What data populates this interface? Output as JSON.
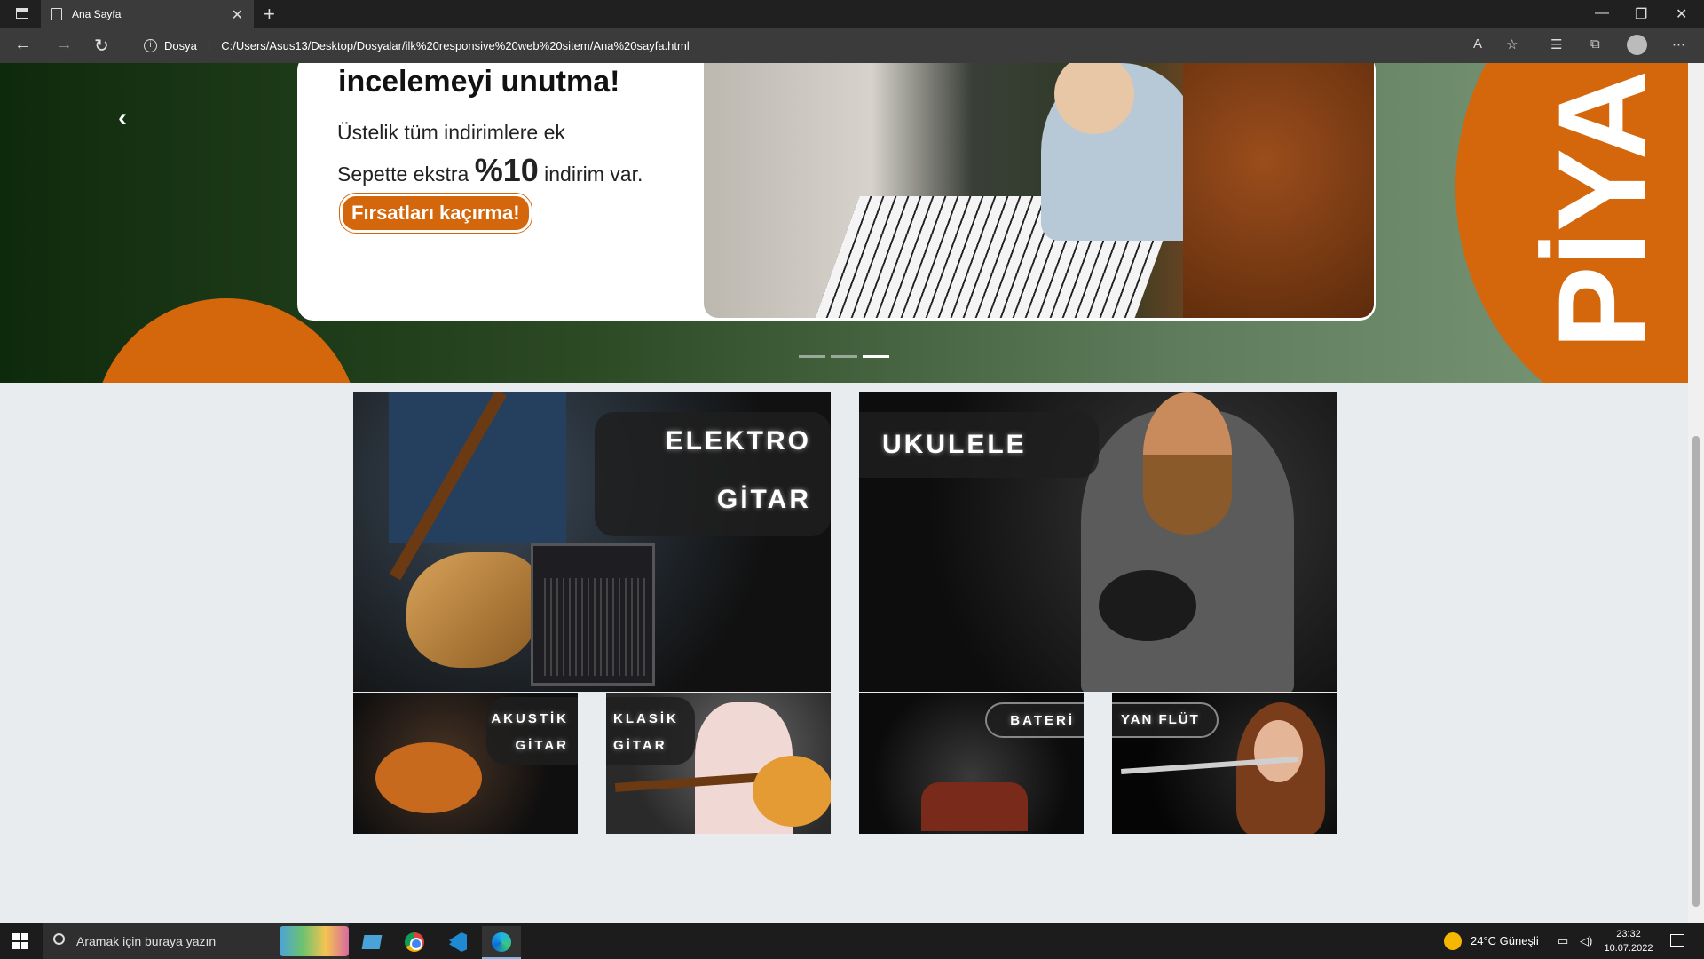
{
  "browser": {
    "tab_title": "Ana Sayfa",
    "new_tab": "+",
    "close_tab": "✕",
    "security_label": "Dosya",
    "url": "C:/Users/Asus13/Desktop/Dosyalar/ilk%20responsive%20web%20sitem/Ana%20sayfa.html",
    "window_minimize": "—",
    "window_restore": "❐",
    "window_close": "✕"
  },
  "hero": {
    "heading": "incelemeyi unutma!",
    "line1": "Üstelik tüm indirimlere ek",
    "line2_pre": "Sepette ekstra ",
    "line2_bold": "%10",
    "line2_post": " indirim var.",
    "cta": "Fırsatları kaçırma!",
    "side_text": "PİYA",
    "prev_arrow": "‹",
    "slides": 3,
    "active_slide": 3
  },
  "categories": {
    "elektro_line1": "ELEKTRO",
    "elektro_line2": "GİTAR",
    "ukulele": "UKULELE",
    "akustik_line1": "AKUSTİK",
    "akustik_line2": "GİTAR",
    "klasik_line1": "KLASİK",
    "klasik_line2": "GİTAR",
    "bateri": "BATERİ",
    "flut": "YAN FLÜT"
  },
  "taskbar": {
    "search_placeholder": "Aramak için buraya yazın",
    "weather": "24°C  Güneşli",
    "time": "23:32",
    "date": "10.07.2022"
  },
  "colors": {
    "accent_orange": "#d4660c",
    "hero_green_dark": "#0e2a0c",
    "hero_green_light": "#7c9a79"
  }
}
